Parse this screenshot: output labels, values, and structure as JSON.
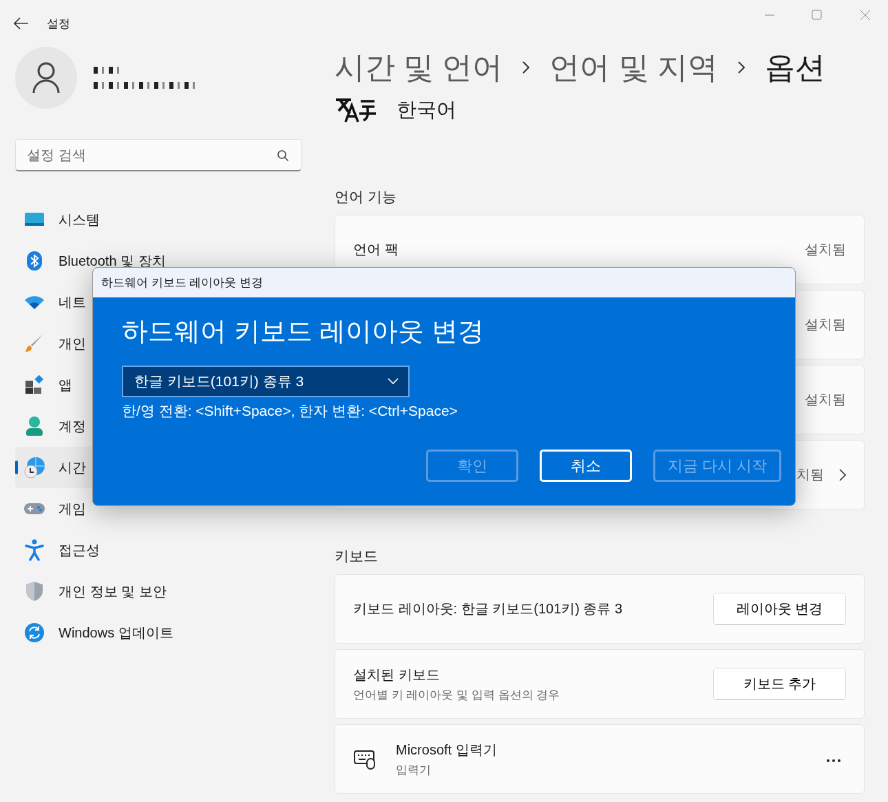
{
  "window": {
    "title": "설정"
  },
  "search": {
    "placeholder": "설정 검색"
  },
  "nav": [
    {
      "label": "시스템",
      "selected": false
    },
    {
      "label": "Bluetooth 및 장치",
      "selected": false
    },
    {
      "label": "네트",
      "selected": false
    },
    {
      "label": "개인",
      "selected": false
    },
    {
      "label": "앱",
      "selected": false
    },
    {
      "label": "계정",
      "selected": false
    },
    {
      "label": "시간",
      "selected": true
    },
    {
      "label": "게임",
      "selected": false
    },
    {
      "label": "접근성",
      "selected": false
    },
    {
      "label": "개인 정보 및 보안",
      "selected": false
    },
    {
      "label": "Windows 업데이트",
      "selected": false
    }
  ],
  "breadcrumb": [
    "시간 및 언어",
    "언어 및 지역",
    "옵션"
  ],
  "language": "한국어",
  "sections": [
    {
      "title": "언어 기능",
      "cards": [
        {
          "kind": "status",
          "label": "언어 팩",
          "status": "설치됨"
        },
        {
          "kind": "status",
          "status": "설치됨"
        },
        {
          "kind": "status",
          "status": "설치됨"
        },
        {
          "kind": "link",
          "status": "치됨"
        }
      ]
    },
    {
      "title": "키보드",
      "cards": [
        {
          "kind": "button",
          "label": "키보드 레이아웃: 한글 키보드(101키) 종류 3",
          "button": "레이아웃 변경"
        },
        {
          "kind": "button",
          "label": "설치된 키보드",
          "sublabel": "언어별 키 레이아웃 및 입력 옵션의 경우",
          "button": "키보드 추가"
        },
        {
          "kind": "item",
          "label": "Microsoft 입력기",
          "sublabel": "입력기"
        }
      ]
    }
  ],
  "dialog": {
    "title": "하드웨어 키보드 레이아웃 변경",
    "heading": "하드웨어 키보드 레이아웃 변경",
    "dropdown": "한글 키보드(101키) 종류 3",
    "hint": "한/영 전환: <Shift+Space>, 한자 변환: <Ctrl+Space>",
    "buttons": [
      {
        "label": "확인",
        "disabled": true
      },
      {
        "label": "취소",
        "disabled": false
      },
      {
        "label": "지금 다시 시작",
        "disabled": true
      }
    ]
  }
}
